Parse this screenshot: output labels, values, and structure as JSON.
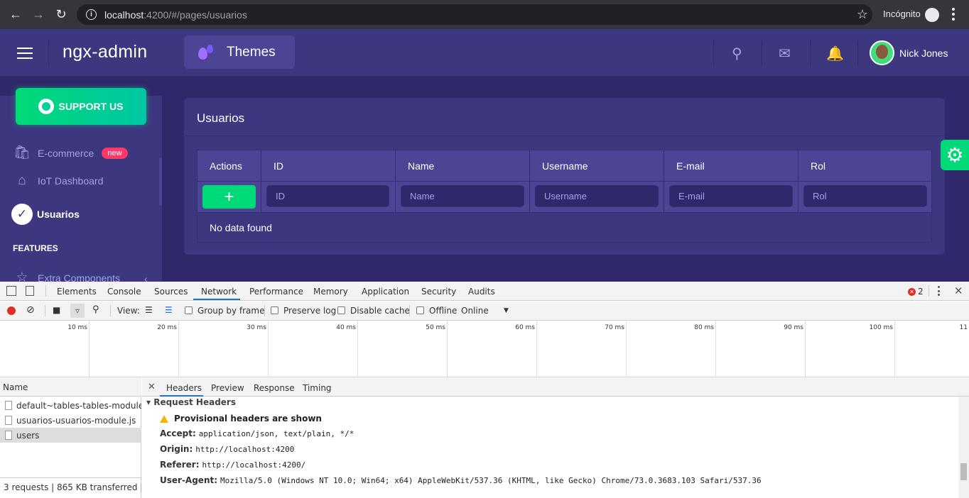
{
  "browser": {
    "url_host": "localhost",
    "url_rest": ":4200/#/pages/usuarios",
    "incognito_label": "Incógnito"
  },
  "header": {
    "brand": "ngx-admin",
    "themes_label": "Themes",
    "user_name": "Nick Jones"
  },
  "sidebar": {
    "support_label": "SUPPORT US",
    "items": [
      {
        "label": "E-commerce",
        "badge": "new",
        "icon": "shopping-bag-icon"
      },
      {
        "label": "IoT Dashboard",
        "icon": "home-icon"
      },
      {
        "label": "Usuarios",
        "icon": "checkmark-icon"
      }
    ],
    "features_label": "FEATURES",
    "extra_label": "Extra Components"
  },
  "card": {
    "title": "Usuarios",
    "columns": [
      "Actions",
      "ID",
      "Name",
      "Username",
      "E-mail",
      "Rol"
    ],
    "filters": [
      "ID",
      "Name",
      "Username",
      "E-mail",
      "Rol"
    ],
    "add_label": "+",
    "empty_text": "No data found"
  },
  "devtools": {
    "tabs": [
      "Elements",
      "Console",
      "Sources",
      "Network",
      "Performance",
      "Memory",
      "Application",
      "Security",
      "Audits"
    ],
    "active_tab": "Network",
    "error_count": "2",
    "toolbar": {
      "view_label": "View:",
      "group_by_frame": "Group by frame",
      "preserve_log": "Preserve log",
      "disable_cache": "Disable cache",
      "offline": "Offline",
      "throttle": "Online"
    },
    "timeline_ticks": [
      "10 ms",
      "20 ms",
      "30 ms",
      "40 ms",
      "50 ms",
      "60 ms",
      "70 ms",
      "80 ms",
      "90 ms",
      "100 ms",
      "11"
    ],
    "requests_header": "Name",
    "requests": [
      "default~tables-tables-module...",
      "usuarios-usuarios-module.js",
      "users"
    ],
    "footer": "3 requests  |  865 KB transferred  |  ...",
    "detail_tabs": [
      "Headers",
      "Preview",
      "Response",
      "Timing"
    ],
    "section_title": "Request Headers",
    "warning": "Provisional headers are shown",
    "headers": [
      {
        "key": "Accept:",
        "value": "application/json, text/plain, */*"
      },
      {
        "key": "Origin:",
        "value": "http://localhost:4200"
      },
      {
        "key": "Referer:",
        "value": "http://localhost:4200/"
      },
      {
        "key": "User-Agent:",
        "value": "Mozilla/5.0 (Windows NT 10.0; Win64; x64) AppleWebKit/537.36 (KHTML, like Gecko) Chrome/73.0.3683.103 Safari/537.36"
      }
    ]
  },
  "colors": {
    "header_bg": "#3d3780",
    "body_bg": "#2f296b",
    "accent_green": "#00d977",
    "badge_pink": "#ff386a"
  }
}
